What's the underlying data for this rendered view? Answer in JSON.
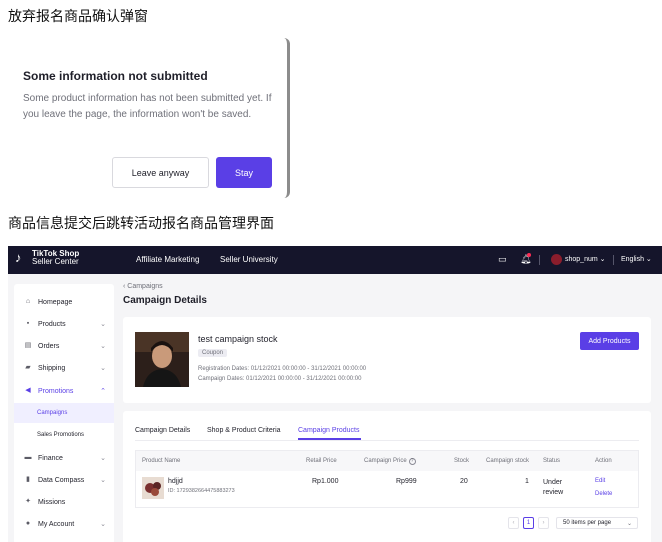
{
  "captions": {
    "top": "放弃报名商品确认弹窗",
    "bottom": "商品信息提交后跳转活动报名商品管理界面"
  },
  "modal": {
    "title": "Some information not submitted",
    "body": "Some product information has not been submitted yet. If you leave the page, the information won't be saved.",
    "leave_label": "Leave anyway",
    "stay_label": "Stay"
  },
  "topbar": {
    "logo_mark": "♪",
    "logo_line1": "TikTok Shop",
    "logo_line2": "Seller Center",
    "nav": [
      "Affiliate Marketing",
      "Seller University"
    ],
    "shop_name": "shop_num ⌄",
    "language": "English ⌄",
    "icons": [
      "chat-icon",
      "bell-icon"
    ]
  },
  "sidebar": {
    "items": [
      {
        "label": "Homepage",
        "icon": "home-icon"
      },
      {
        "label": "Products",
        "icon": "box-icon"
      },
      {
        "label": "Orders",
        "icon": "orders-icon"
      },
      {
        "label": "Shipping",
        "icon": "truck-icon"
      },
      {
        "label": "Promotions",
        "icon": "megaphone-icon"
      },
      {
        "label": "Finance",
        "icon": "wallet-icon"
      },
      {
        "label": "Data Compass",
        "icon": "chart-icon"
      },
      {
        "label": "Missions",
        "icon": "mission-icon"
      },
      {
        "label": "My Account",
        "icon": "user-icon"
      }
    ],
    "sub_items": [
      "Campaigns",
      "Sales Promotions"
    ]
  },
  "main": {
    "breadcrumb": "‹ Campaigns",
    "title": "Campaign Details",
    "campaign": {
      "name": "test campaign stock",
      "tag": "Coupon",
      "registration_dates": "Registration Dates: 01/12/2021 00:00:00 - 31/12/2021 00:00:00",
      "campaign_dates": "Campaign Dates: 01/12/2021 00:00:00 - 31/12/2021 00:00:00",
      "add_products_label": "Add Products"
    },
    "tabs": [
      "Campaign Details",
      "Shop & Product Criteria",
      "Campaign Products"
    ],
    "active_tab": "Campaign Products",
    "table": {
      "headers": [
        "Product Name",
        "Retail Price",
        "Campaign Price",
        "Stock",
        "Campaign stock",
        "Status",
        "Action"
      ],
      "rows": [
        {
          "name": "hdjjd",
          "id": "ID: 1729382664475883273",
          "retail_price": "Rp1.000",
          "campaign_price": "Rp999",
          "stock": "20",
          "campaign_stock": "1",
          "status": "Under review",
          "actions": [
            "Edit",
            "Delete"
          ]
        }
      ]
    },
    "pagination": {
      "current_page": "1",
      "page_size": "50 items per page"
    }
  },
  "colors": {
    "accent": "#5a3fe6",
    "topbar": "#15152b",
    "background": "#f5f5f7"
  }
}
